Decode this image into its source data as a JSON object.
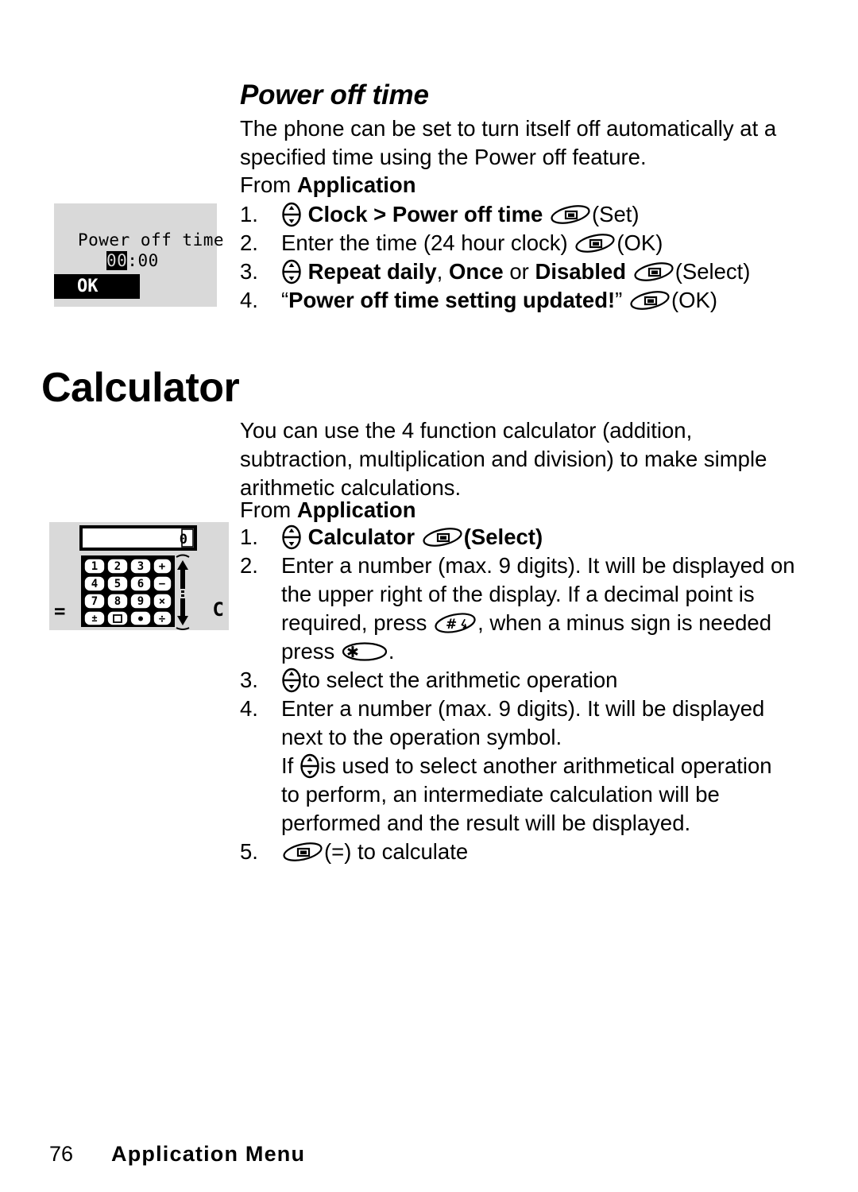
{
  "page": {
    "number": "76",
    "footer_title": "Application Menu",
    "background_color": "#ffffff",
    "text_color": "#000000"
  },
  "section_power_off": {
    "heading": "Power off time",
    "intro": "The phone can be set to turn itself off automatically at a specified time using the Power off feature.",
    "from_prefix": "From ",
    "from_target": "Application",
    "steps": [
      {
        "number": "1.",
        "parts": [
          {
            "type": "icon",
            "name": "navigation-key-icon"
          },
          {
            "type": "bold",
            "text": "Clock > Power off time"
          },
          {
            "type": "icon",
            "name": "soft-key-icon"
          },
          {
            "type": "plain",
            "text": "(Set)"
          }
        ],
        "plain_text": "Clock > Power off time (Set)"
      },
      {
        "number": "2.",
        "parts": [
          {
            "type": "plain",
            "text": "Enter the time (24 hour clock)"
          },
          {
            "type": "icon",
            "name": "soft-key-icon"
          },
          {
            "type": "plain",
            "text": "(OK)"
          }
        ],
        "plain_text": "Enter the time (24 hour clock) (OK)"
      },
      {
        "number": "3.",
        "parts": [
          {
            "type": "icon",
            "name": "navigation-key-icon"
          },
          {
            "type": "bold",
            "text": "Repeat daily"
          },
          {
            "type": "plain",
            "text": ", "
          },
          {
            "type": "bold",
            "text": "Once"
          },
          {
            "type": "plain",
            "text": " or "
          },
          {
            "type": "bold",
            "text": "Disabled"
          },
          {
            "type": "icon",
            "name": "soft-key-icon"
          },
          {
            "type": "plain",
            "text": "(Select)"
          }
        ],
        "plain_text": "Repeat daily, Once or Disabled (Select)"
      },
      {
        "number": "4.",
        "parts": [
          {
            "type": "plain",
            "text": "“"
          },
          {
            "type": "bold",
            "text": "Power off time setting updated!"
          },
          {
            "type": "plain",
            "text": "”"
          },
          {
            "type": "icon",
            "name": "soft-key-icon"
          },
          {
            "type": "plain",
            "text": "(OK)"
          }
        ],
        "plain_text": "“Power off time setting updated!” (OK)"
      }
    ],
    "screenshot": {
      "name": "power-off-time-phone-screen",
      "background_color": "#d9d9d9",
      "title_text": "Power off time",
      "time_highlighted": "00",
      "time_separator": ":",
      "time_rest": "00",
      "softkey_label": "OK",
      "softkey_background": "#000000",
      "softkey_text_color": "#ffffff"
    }
  },
  "section_calculator": {
    "heading": "Calculator",
    "intro": "You can use the 4 function calculator (addition, subtraction, multiplication and division) to make simple arithmetic calculations.",
    "from_prefix": "From ",
    "from_target": "Application",
    "steps": [
      {
        "number": "1.",
        "plain_text": "Calculator (Select)"
      },
      {
        "number": "2.",
        "plain_text": "Enter a number (max. 9 digits). It will be displayed on the upper right of the display. If a decimal point is required, press , when a minus sign is needed press ."
      },
      {
        "number": "3.",
        "plain_text": "to select the arithmetic operation"
      },
      {
        "number": "4.",
        "plain_text": "Enter a number (max. 9 digits). It will be displayed next to the operation symbol. If is used to select another arithmetical operation to perform, an intermediate calculation will be performed and the result will be displayed."
      },
      {
        "number": "5.",
        "plain_text": "(=) to calculate"
      }
    ],
    "step1": {
      "label_bold": "Calculator",
      "softkey_label": "(Select)"
    },
    "step2": {
      "line1": "Enter a number (max. 9 digits). It will be displayed on the",
      "line2": "upper right of the display. If a decimal point is required,",
      "line3_before": "press",
      "line3_mid": ", when a minus sign is needed press",
      "line3_after": "."
    },
    "step3": {
      "text": "to select the arithmetic operation"
    },
    "step4": {
      "line1": "Enter a number (max. 9 digits). It will be displayed next",
      "line2": "to the operation symbol.",
      "line3_before": "If",
      "line3_after": "is used to select another arithmetical operation to",
      "line4": "perform, an intermediate calculation will be performed",
      "line5": "and the result will be displayed."
    },
    "step5": {
      "text": "(=) to calculate"
    },
    "screenshot": {
      "name": "calculator-phone-screen",
      "background_color": "#d9d9d9",
      "display_value": "0",
      "keys": [
        [
          "1",
          "2",
          "3",
          "+"
        ],
        [
          "4",
          "5",
          "6",
          "−"
        ],
        [
          "7",
          "8",
          "9",
          "×"
        ],
        [
          "±",
          "□",
          "●",
          "÷"
        ]
      ],
      "scroll_up": "↑",
      "scroll_down": "↓",
      "left_softkey": "=",
      "right_softkey": "C"
    }
  },
  "icons": {
    "navigation_key": "navigation-key-icon",
    "soft_key": "soft-key-icon",
    "hash_key": "hash-key-icon",
    "star_key": "star-key-icon"
  }
}
